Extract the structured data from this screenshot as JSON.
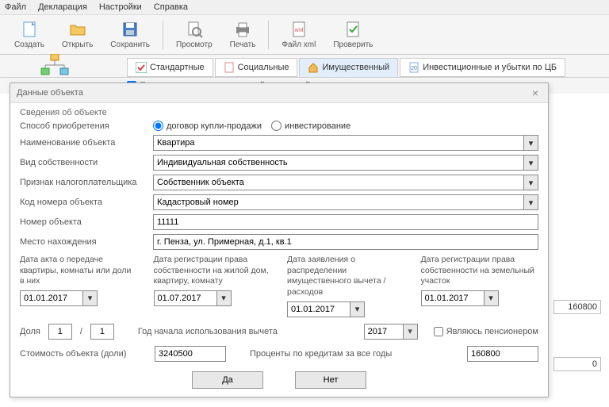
{
  "menu": {
    "file": "Файл",
    "declaration": "Декларация",
    "settings": "Настройки",
    "help": "Справка"
  },
  "toolbar": {
    "create": "Создать",
    "open": "Открыть",
    "save": "Сохранить",
    "view": "Просмотр",
    "print": "Печать",
    "xml": "Файл xml",
    "check": "Проверить"
  },
  "tabs": {
    "standard": "Стандартные",
    "social": "Социальные",
    "property": "Имущественный",
    "invest": "Инвестиционные и убытки по ЦБ"
  },
  "grant_checkbox": "Предоставить имущественный налоговый вычет",
  "dialog": {
    "title": "Данные объекта",
    "section": "Сведения об объекте",
    "labels": {
      "acq_method": "Способ приобретения",
      "obj_name": "Наименование объекта",
      "ownership": "Вид собственности",
      "taxpayer_sign": "Признак налогоплательщика",
      "number_code": "Код номера объекта",
      "obj_number": "Номер объекта",
      "location": "Место нахождения"
    },
    "radio": {
      "contract": "договор купли-продажи",
      "invest": "инвестирование"
    },
    "values": {
      "obj_name": "Квартира",
      "ownership": "Индивидуальная собственность",
      "taxpayer_sign": "Собственник объекта",
      "number_code": "Кадастровый номер",
      "obj_number": "11111",
      "location": "г. Пенза, ул. Примерная, д.1, кв.1"
    },
    "cols": {
      "c1": "Дата акта о передаче квартиры, комнаты или доли в них",
      "c2": "Дата регистрации права собственности на жилой дом, квартиру, комнату",
      "c3": "Дата заявления о распределении имущественного вычета / расходов",
      "c4": "Дата регистрации права собственности на земельный участок",
      "d1": "01.01.2017",
      "d2": "01.07.2017",
      "d3": "01.01.2017",
      "d4": "01.01.2017"
    },
    "share_label": "Доля",
    "share_a": "1",
    "share_b": "1",
    "year_label": "Год начала использования вычета",
    "year_val": "2017",
    "pensioner": "Являюсь пенсионером",
    "cost_label": "Стоимость объекта (доли)",
    "cost_val": "3240500",
    "interest_label": "Проценты по кредитам за все годы",
    "interest_val": "160800",
    "yes": "Да",
    "no": "Нет"
  },
  "bg": {
    "v1": "160800",
    "v2": "0"
  }
}
